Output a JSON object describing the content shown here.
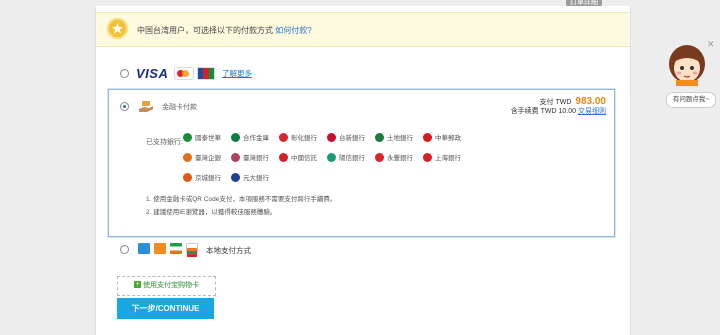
{
  "top_tab": {
    "label": "訂單詳細"
  },
  "notice": {
    "text": "中国台湾用户，可选择以下的付款方式",
    "link": "如何付款?"
  },
  "card_option": {
    "brands": [
      "VISA",
      "MasterCard",
      "JCB"
    ],
    "learn_more": "了解更多"
  },
  "bank_option": {
    "method_label": "金融卡付款",
    "pay_label": "支付 TWD",
    "amount": "983.00",
    "fee_prefix": "含手续费 TWD 10.00",
    "fee_link": "交易细则",
    "supported_label": "已支持銀行:",
    "banks": [
      {
        "name": "國泰世華",
        "color": "#1a8a3c"
      },
      {
        "name": "合作金庫",
        "color": "#0d7d43"
      },
      {
        "name": "彰化銀行",
        "color": "#d22630"
      },
      {
        "name": "台新銀行",
        "color": "#c8102e"
      },
      {
        "name": "土地銀行",
        "color": "#1c7a3a"
      },
      {
        "name": "中華郵政",
        "color": "#d71920"
      },
      {
        "name": "臺灣企銀",
        "color": "#e2701a"
      },
      {
        "name": "臺灣銀行",
        "color": "#b0415a"
      },
      {
        "name": "中國信託",
        "color": "#d21f2d"
      },
      {
        "name": "陽信銀行",
        "color": "#1b9a7a"
      },
      {
        "name": "永豐銀行",
        "color": "#d8262f"
      },
      {
        "name": "上海銀行",
        "color": "#d81f26"
      },
      {
        "name": "京城銀行",
        "color": "#e05a15"
      },
      {
        "name": "元大銀行",
        "color": "#1f3f95"
      }
    ],
    "notes": [
      "1. 使用金融卡或QR Code支付，本項服務不需要支付跨行手續費。",
      "2. 建議使用IE瀏覽器，以獲得較佳服務體驗。"
    ]
  },
  "local_option": {
    "label": "本地支付方式"
  },
  "giftcard_link": "使用支付宝购物卡",
  "next_button": "下一步/CONTINUE",
  "helper": {
    "bubble": "有问题点我~"
  },
  "colors": {
    "accent": "#1aa6e0",
    "link": "#2a75c8",
    "amount": "#e58a10"
  }
}
